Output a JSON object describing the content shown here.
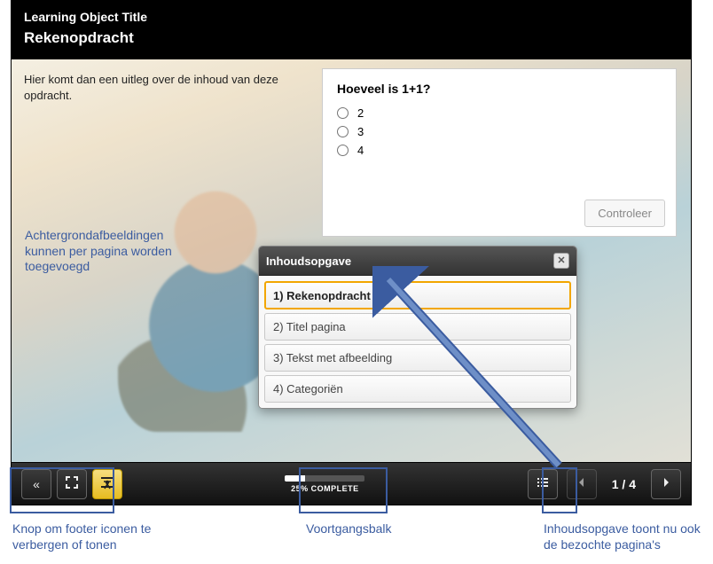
{
  "header": {
    "lo_title": "Learning Object Title",
    "page_title": "Rekenopdracht"
  },
  "description": "Hier komt dan een uitleg over de inhoud van deze opdracht.",
  "quiz": {
    "question": "Hoeveel is 1+1?",
    "options": [
      "2",
      "3",
      "4"
    ],
    "check_label": "Controleer"
  },
  "toc": {
    "title": "Inhoudsopgave",
    "items": [
      {
        "label": "1) Rekenopdracht",
        "active": true,
        "visited": true
      },
      {
        "label": "2) Titel pagina",
        "active": false,
        "visited": false
      },
      {
        "label": "3) Tekst met afbeelding",
        "active": false,
        "visited": false
      },
      {
        "label": "4) Categoriën",
        "active": false,
        "visited": false
      }
    ]
  },
  "progress": {
    "percent": 25,
    "label": "25% COMPLETE"
  },
  "pager": {
    "current": 1,
    "total": 4,
    "display": "1 / 4"
  },
  "annotations": {
    "bg_images": "Achtergrondafbeeldingen kunnen per pagina worden toegevoegd",
    "footer_toggle": "Knop om footer iconen te verbergen of tonen",
    "progressbar": "Voortgangsbalk",
    "toc_visited": "Inhoudsopgave toont nu ook de bezochte pagina's"
  }
}
